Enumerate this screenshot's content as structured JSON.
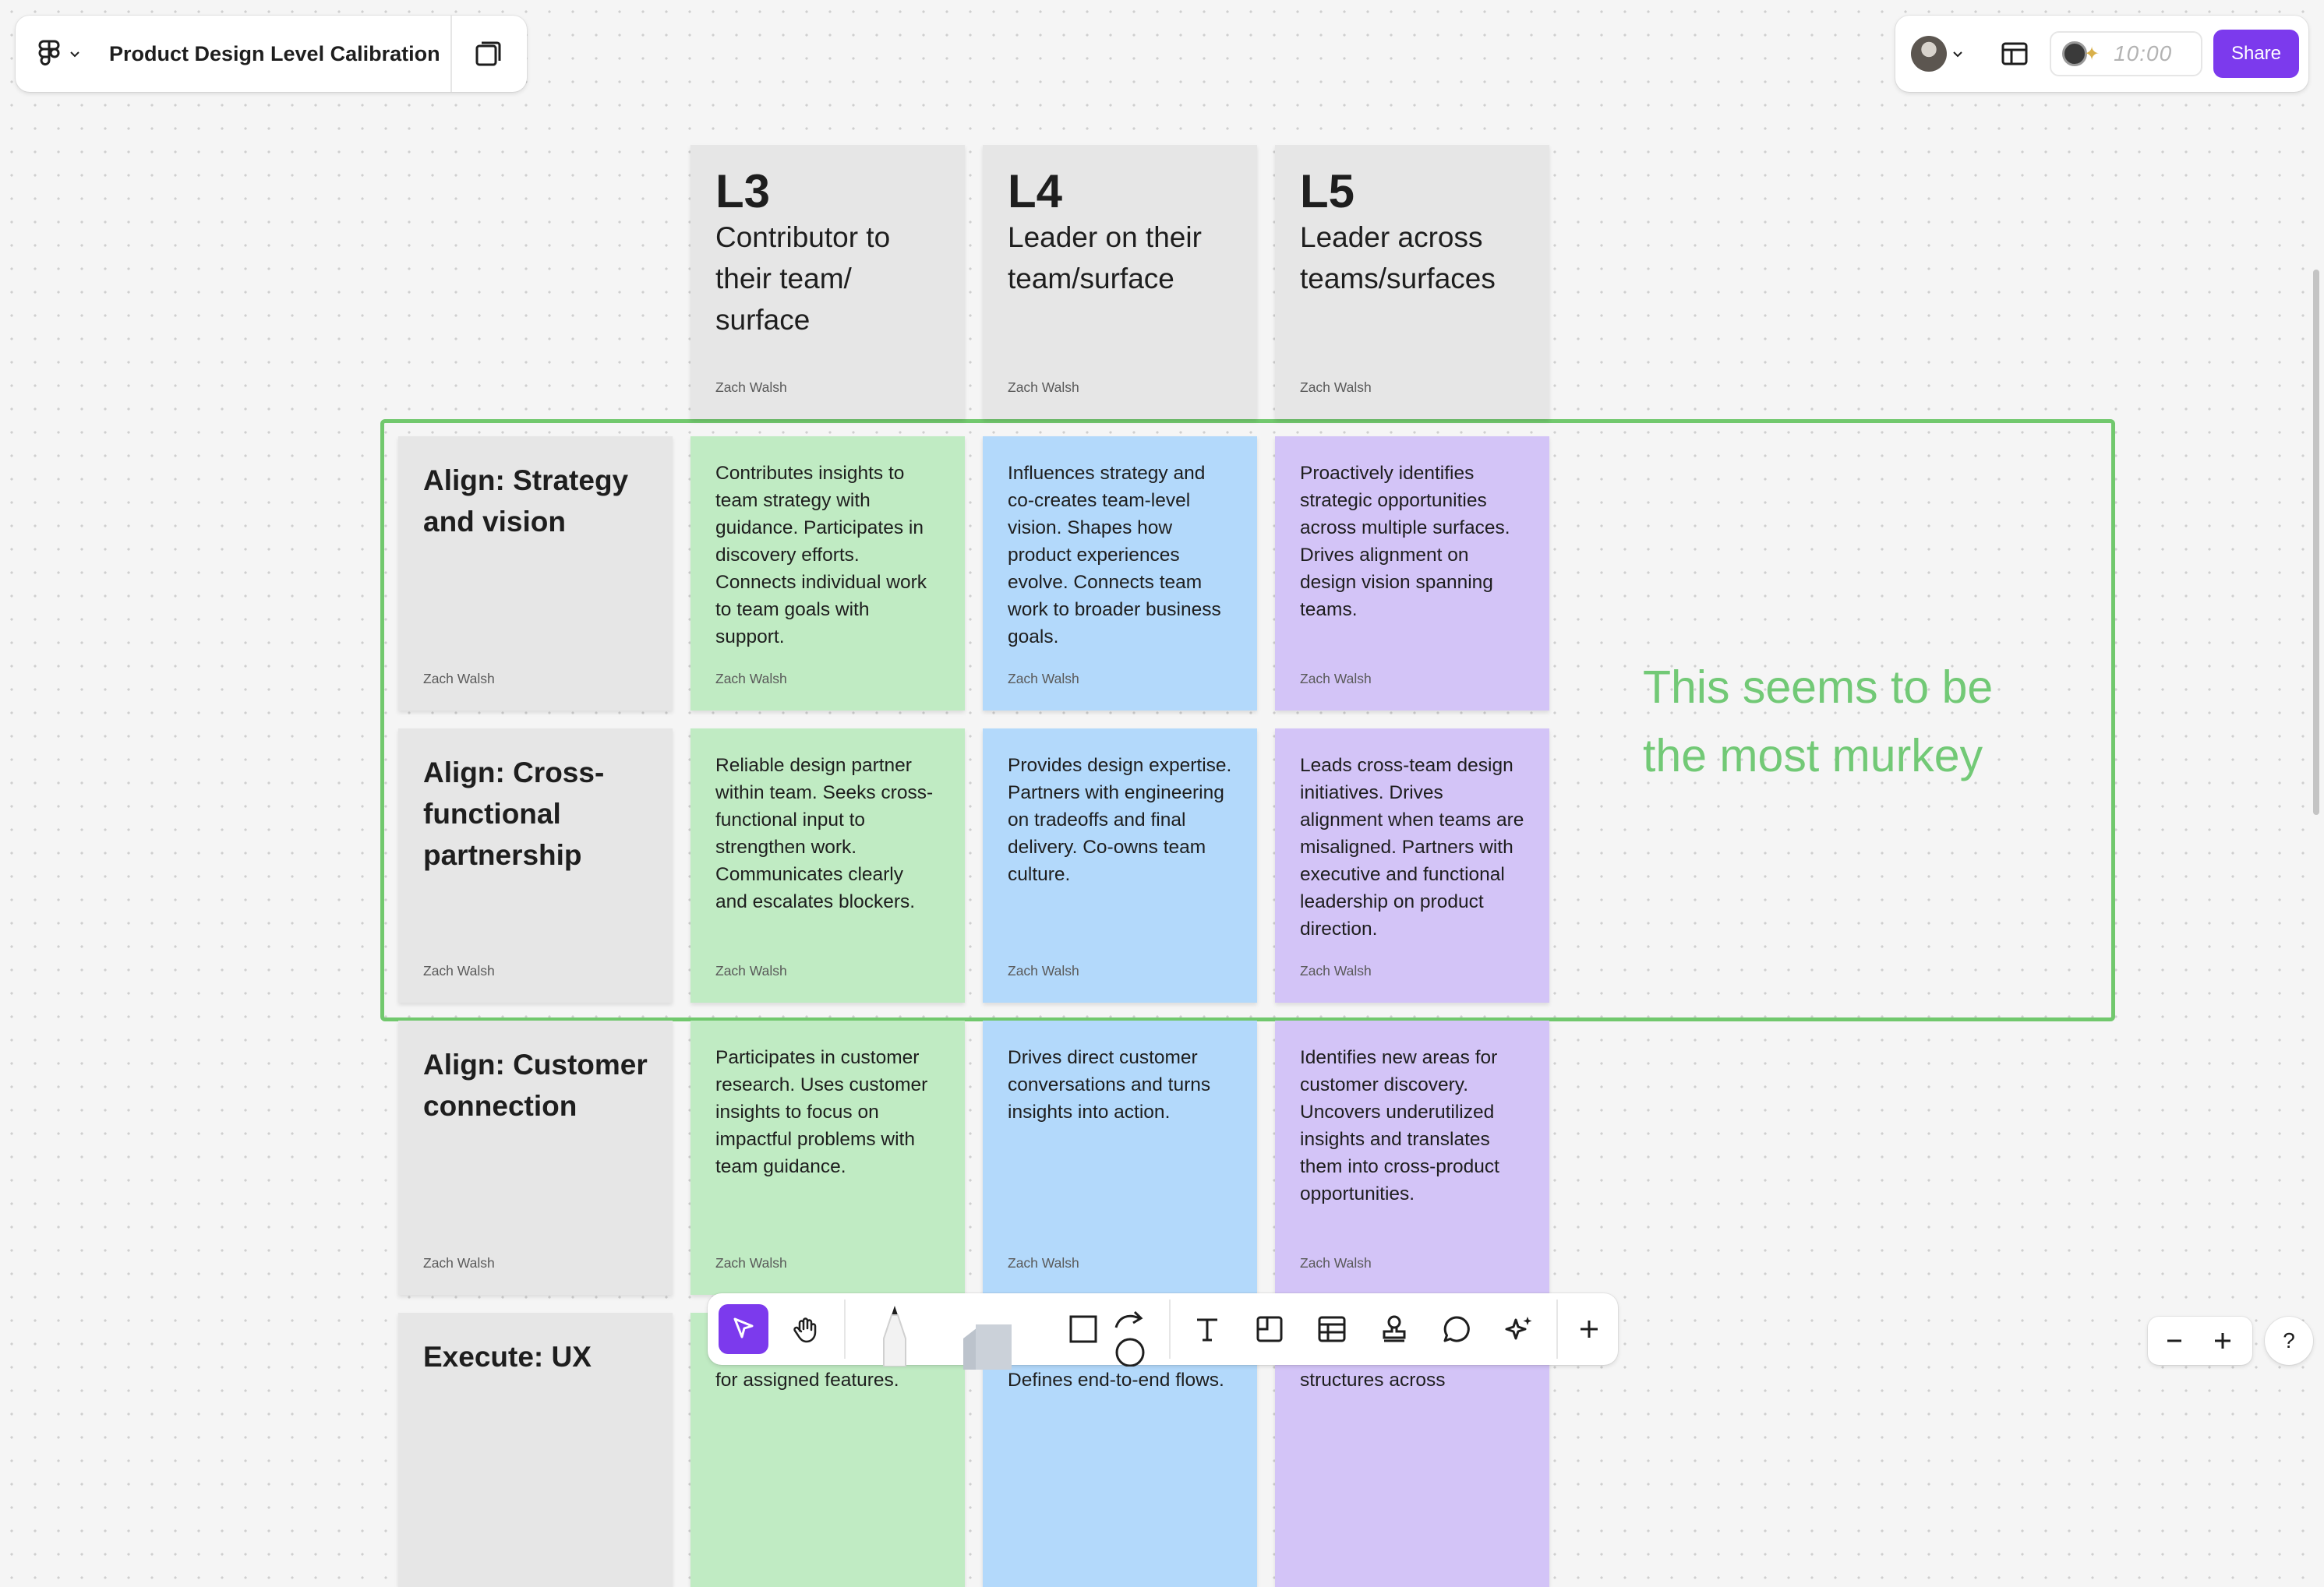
{
  "app": {
    "file_title": "Product Design Level Calibration",
    "timer": "10:00",
    "share_label": "Share"
  },
  "colors": {
    "accent": "#7c3aed",
    "sticky_gray": "#e6e6e6",
    "sticky_green": "#c0ebc3",
    "sticky_blue": "#b3d9fb",
    "sticky_purple": "#d3c4f7",
    "section_border": "#71c86d",
    "annotation_text": "#72c976"
  },
  "columns": [
    {
      "level": "L3",
      "subtitle": "Contributor to their team/ surface",
      "author": "Zach Walsh"
    },
    {
      "level": "L4",
      "subtitle": "Leader on their team/surface",
      "author": "Zach Walsh"
    },
    {
      "level": "L5",
      "subtitle": "Leader across teams/surfaces",
      "author": "Zach Walsh"
    }
  ],
  "rows": [
    {
      "title": "Align: Strategy and vision",
      "author": "Zach Walsh",
      "cells": [
        {
          "text": "Contributes insights to team strategy with guidance. Participates in discovery efforts. Connects individual work to team goals with support.",
          "author": "Zach Walsh"
        },
        {
          "text": "Influences strategy and co-creates team-level vision. Shapes how product experiences evolve. Connects team work to broader business goals.",
          "author": "Zach Walsh"
        },
        {
          "text": "Proactively identifies strategic opportunities across multiple surfaces. Drives alignment on design vision spanning teams.",
          "author": "Zach Walsh"
        }
      ]
    },
    {
      "title": "Align: Cross-functional partnership",
      "author": "Zach Walsh",
      "cells": [
        {
          "text": "Reliable design partner within team. Seeks cross-functional input to strengthen work. Communicates clearly and escalates blockers.",
          "author": "Zach Walsh"
        },
        {
          "text": "Provides design expertise. Partners with engineering on tradeoffs and final delivery. Co-owns team culture.",
          "author": "Zach Walsh"
        },
        {
          "text": "Leads cross-team design initiatives. Drives alignment when teams are misaligned. Partners with executive and functional leadership on product direction.",
          "author": "Zach Walsh"
        }
      ]
    },
    {
      "title": "Align: Customer connection",
      "author": "Zach Walsh",
      "cells": [
        {
          "text": "Participates in customer research. Uses customer insights to focus on impactful problems with team guidance.",
          "author": "Zach Walsh"
        },
        {
          "text": "Drives direct customer conversations and turns insights into action.",
          "author": "Zach Walsh"
        },
        {
          "text": "Identifies new areas for customer discovery. Uncovers underutilized insights and translates them into cross-product opportunities.",
          "author": "Zach Walsh"
        }
      ]
    },
    {
      "title": "Execute: UX",
      "cells": [
        {
          "text": "for assigned features."
        },
        {
          "text": "Defines end-to-end flows."
        },
        {
          "text": "structures across"
        }
      ]
    }
  ],
  "annotation": "This seems to be the most murkey",
  "zoom": {
    "help_label": "?"
  }
}
